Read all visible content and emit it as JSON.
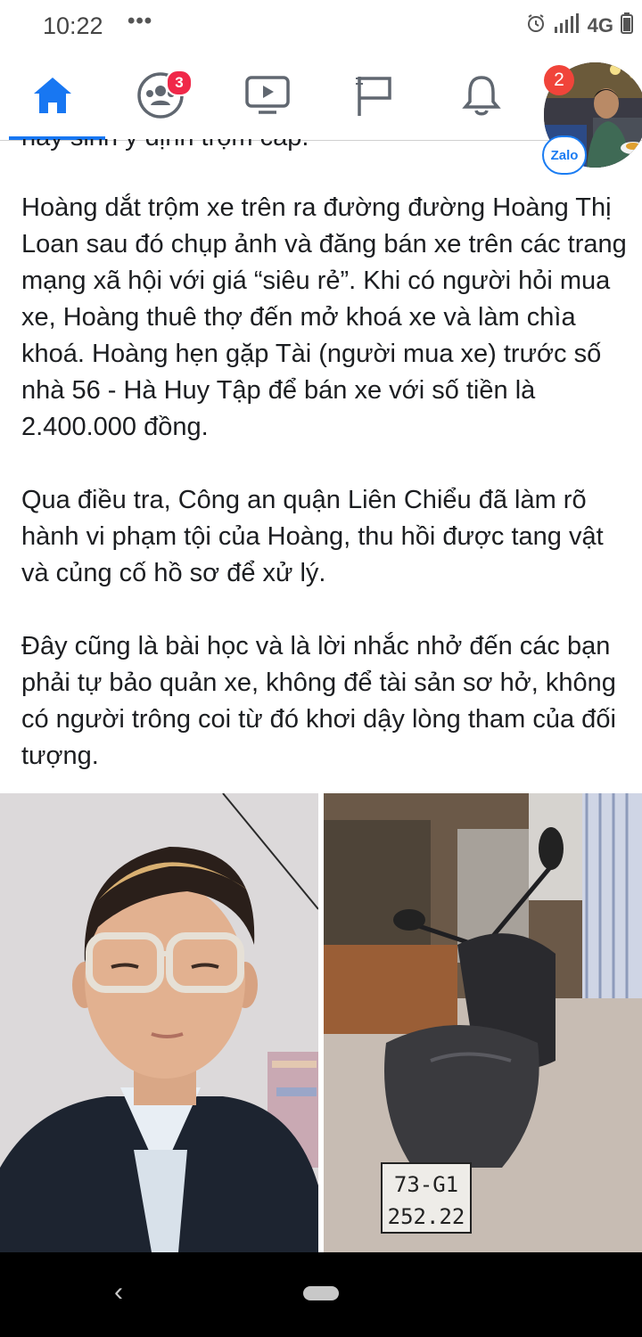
{
  "status_bar": {
    "time": "10:22",
    "dots": "•••",
    "network": "4G"
  },
  "nav": {
    "items": [
      "home",
      "groups",
      "watch",
      "pages",
      "notifications"
    ],
    "groups_badge": "3"
  },
  "chat_head": {
    "badge": "2",
    "app_label": "Zalo"
  },
  "article": {
    "cut_line": "hay sinh ý định trộm cắp.",
    "paragraphs": [
      "Hoàng dắt trộm xe trên ra đường đường Hoàng Thị Loan sau đó chụp ảnh và đăng bán xe trên các trang mạng xã hội với giá “siêu rẻ”. Khi có người hỏi mua xe, Hoàng thuê thợ đến mở khoá xe và làm chìa khoá. Hoàng hẹn gặp Tài (người mua xe) trước số nhà 56 - Hà Huy Tập để bán xe với số tiền là 2.400.000 đồng.",
      "Qua điều tra, Công an quận Liên Chiểu đã làm rõ hành vi phạm tội của Hoàng, thu hồi được tang vật và củng cố hồ sơ để xử lý.",
      "Đây cũng là bài học và là lời nhắc nhở đến các bạn phải tự bảo quản xe, không để tài sản sơ hở, không có người trông coi từ đó khơi dậy lòng tham của đối tượng."
    ]
  },
  "photos": {
    "plate_line1": "73-G1",
    "plate_line2": "252.22"
  },
  "android_nav": {
    "back": "‹"
  }
}
